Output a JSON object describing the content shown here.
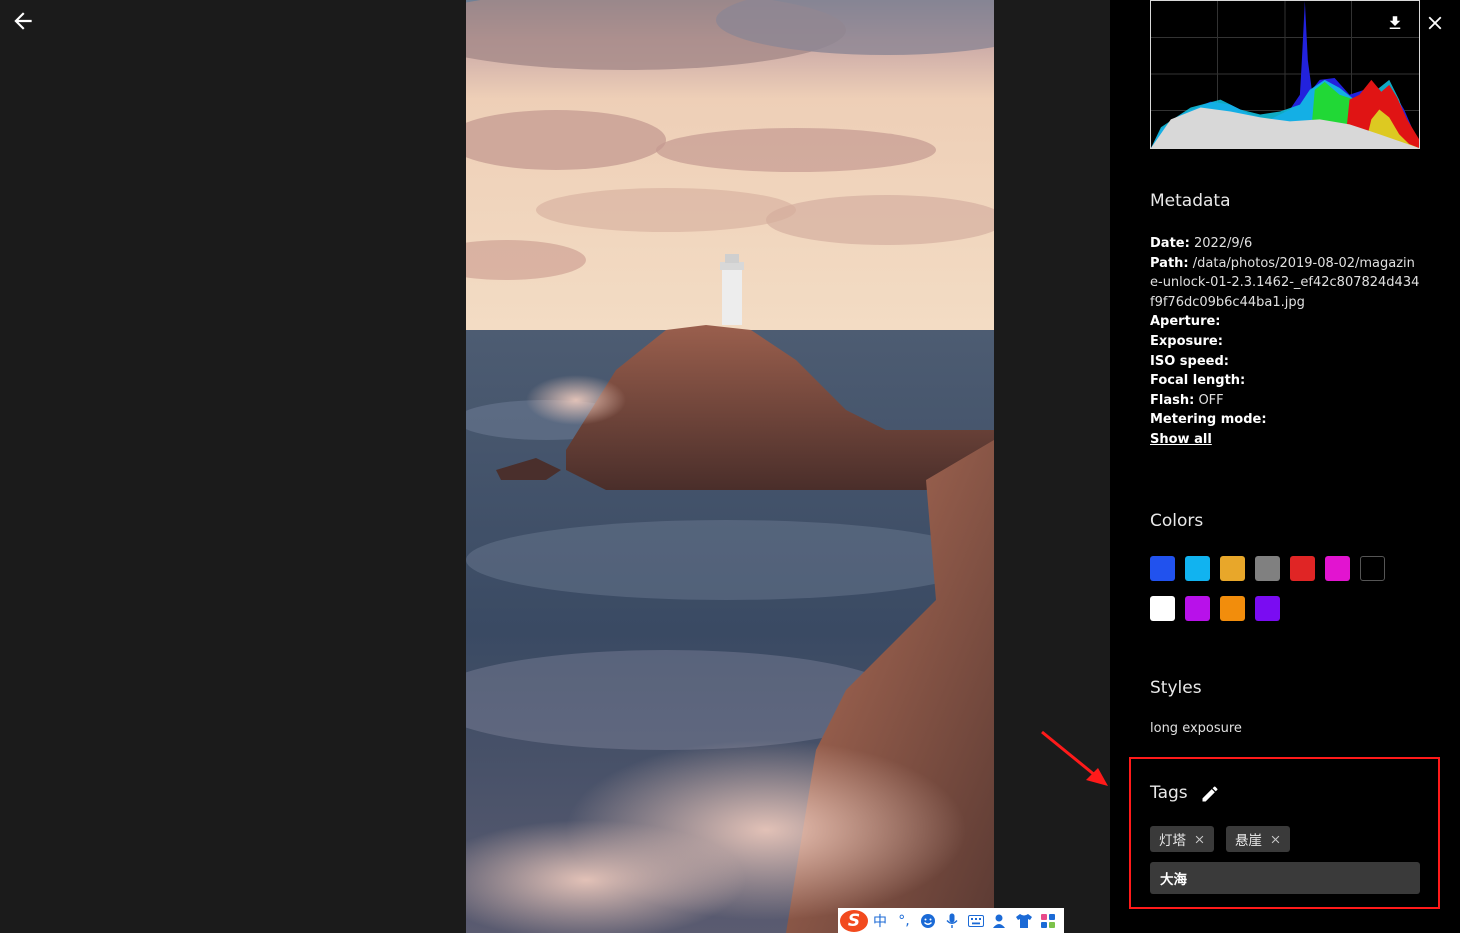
{
  "metadata": {
    "title": "Metadata",
    "date_label": "Date:",
    "date_value": "2022/9/6",
    "path_label": "Path:",
    "path_value": "/data/photos/2019-08-02/magazine-unlock-01-2.3.1462-_ef42c807824d434f9f76dc09b6c44ba1.jpg",
    "aperture_label": "Aperture:",
    "exposure_label": "Exposure:",
    "iso_label": "ISO speed:",
    "focal_label": "Focal length:",
    "flash_label": "Flash:",
    "flash_value": "OFF",
    "metering_label": "Metering mode:",
    "show_all": "Show all"
  },
  "colors": {
    "title": "Colors",
    "swatches": [
      "#2152ee",
      "#11b3f0",
      "#e8a72a",
      "#808080",
      "#e02525",
      "#e214d0",
      "#000000",
      "#ffffff",
      "#b811ea",
      "#f28d0c",
      "#7a0cf2"
    ]
  },
  "styles": {
    "title": "Styles",
    "items": [
      "long exposure"
    ]
  },
  "tags": {
    "title": "Tags",
    "chips": [
      "灯塔",
      "悬崖"
    ],
    "input_value": "大海"
  },
  "ime": {
    "logo": "S",
    "mode": "中",
    "punct": "°,"
  },
  "icons": {
    "back": "arrow-left-icon",
    "close": "close-icon",
    "download": "download-icon",
    "edit": "pencil-icon"
  },
  "accent": {
    "highlight": "#ff1a1a",
    "panel_bg": "#000000",
    "viewer_bg": "#1b1b1b"
  }
}
